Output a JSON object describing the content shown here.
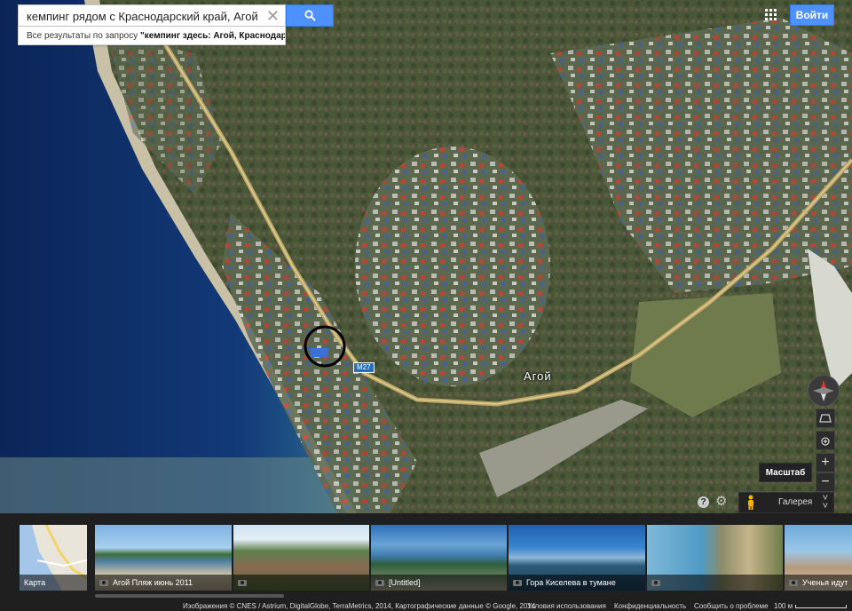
{
  "search": {
    "query": "кемпинг рядом с Краснодарский край, Агой",
    "clear_icon": "close-icon",
    "button_icon": "search-icon",
    "suggestion_prefix": "Все результаты по запросу ",
    "suggestion_bold": "\"кемпинг здесь: Агой, Краснодарск..."
  },
  "header": {
    "apps_icon": "apps-grid-icon",
    "login_label": "Войти"
  },
  "map": {
    "place_label": "Агой",
    "highway_label": "M27",
    "scale_tooltip": "Масштаб",
    "controls": {
      "compass_icon": "compass-icon",
      "tilt_icon": "tilt-icon",
      "locate_icon": "my-location-icon",
      "zoom_in": "+",
      "zoom_out": "−"
    },
    "help_label": "?",
    "settings_icon": "gear-icon",
    "pegman_icon": "pegman-icon",
    "gallery_label": "Галерея",
    "gallery_chevron": "expand-chevron-icon"
  },
  "gallery": {
    "map_thumb_label": "Карта",
    "photos": [
      {
        "caption": "Агой Пляж июнь 2011"
      },
      {
        "caption": ""
      },
      {
        "caption": "[Untitled]"
      },
      {
        "caption": "Гора Киселева в тумане"
      },
      {
        "caption": ""
      },
      {
        "caption": "Ученья идут"
      }
    ]
  },
  "footer": {
    "attribution": "Изображения © CNES / Astrium, DigitalGlobe, TerraMetrics, 2014, Картографические данные © Google, 2014",
    "terms": "Условия использования",
    "privacy": "Конфиденциальность",
    "report": "Сообщить о проблеме",
    "scale": "100 м"
  },
  "colors": {
    "accent": "#4d90fe",
    "sea": "#0f2b5e",
    "terrain": "#4a5a3c",
    "road": "#b8a36a"
  }
}
